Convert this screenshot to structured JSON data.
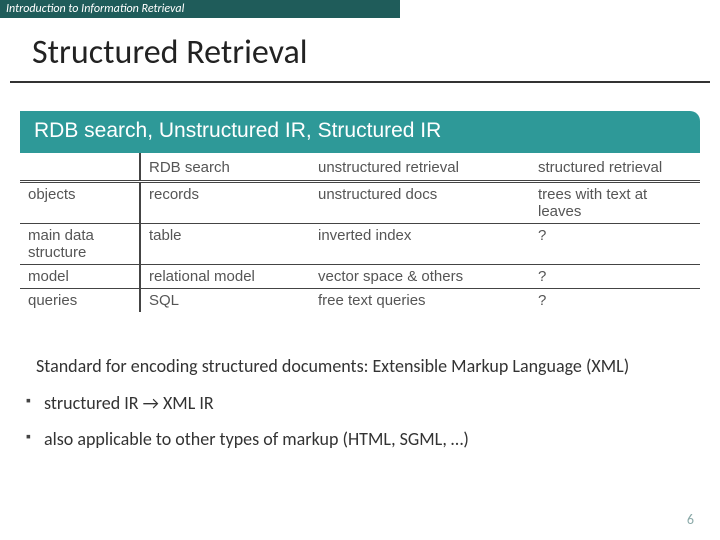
{
  "header": "Introduction to Information Retrieval",
  "title": "Structured Retrieval",
  "subheader": "RDB search, Unstructured IR, Structured IR",
  "table": {
    "columns": [
      "",
      "RDB search",
      "unstructured retrieval",
      "structured retrieval"
    ],
    "rows": [
      {
        "label": "objects",
        "c2": "records",
        "c3": "unstructured docs",
        "c4": "trees with text at leaves"
      },
      {
        "label": "main data structure",
        "c2": "table",
        "c3": "inverted index",
        "c4": "?"
      },
      {
        "label": "model",
        "c2": "relational model",
        "c3": "vector space & others",
        "c4": "?"
      },
      {
        "label": "queries",
        "c2": "SQL",
        "c3": "free text queries",
        "c4": "?"
      }
    ]
  },
  "paragraph": "Standard for encoding structured documents: Extensible Markup Language (XML)",
  "bullets": [
    "structured IR → XML IR",
    "also applicable to other types of markup (HTML, SGML, …)"
  ],
  "page": "6"
}
